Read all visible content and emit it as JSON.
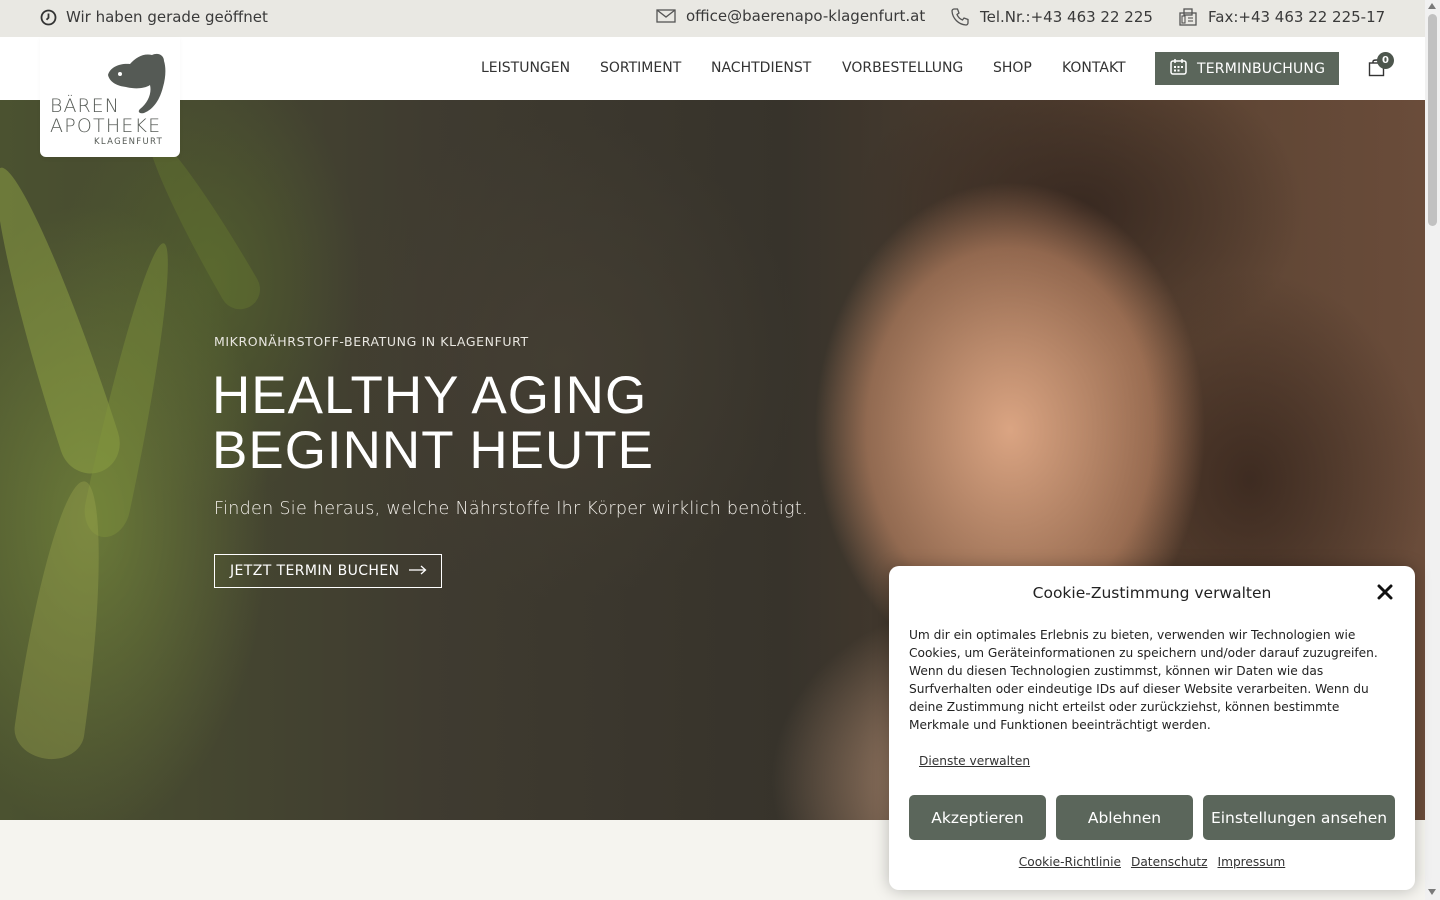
{
  "topbar": {
    "open_status": "Wir haben gerade geöffnet",
    "email": "office@baerenapo-klagenfurt.at",
    "phone": "Tel.Nr.:+43 463 22 225",
    "fax": "Fax:+43 463 22 225-17"
  },
  "logo": {
    "line1": "BÄREN",
    "line2": "APOTHEKE",
    "line3": "KLAGENFURT"
  },
  "nav": {
    "items": [
      "LEISTUNGEN",
      "SORTIMENT",
      "NACHTDIENST",
      "VORBESTELLUNG",
      "SHOP",
      "KONTAKT"
    ],
    "booking_label": "TERMINBUCHUNG",
    "cart_count": "0"
  },
  "hero": {
    "eyebrow": "MIKRONÄHRSTOFF-BERATUNG IN KLAGENFURT",
    "title_line1": "HEALTHY AGING",
    "title_line2": "BEGINNT HEUTE",
    "subtitle": "Finden Sie heraus, welche Nährstoffe Ihr Körper wirklich benötigt.",
    "cta_label": "JETZT TERMIN BUCHEN"
  },
  "cookie": {
    "title": "Cookie-Zustimmung verwalten",
    "body": "Um dir ein optimales Erlebnis zu bieten, verwenden wir Technologien wie Cookies, um Geräteinformationen zu speichern und/oder darauf zuzugreifen. Wenn du diesen Technologien zustimmst, können wir Daten wie das Surfverhalten oder eindeutige IDs auf dieser Website verarbeiten. Wenn du deine Zustimmung nicht erteilst oder zurückziehst, können bestimmte Merkmale und Funktionen beeinträchtigt werden.",
    "manage_link": "Dienste verwalten",
    "accept": "Akzeptieren",
    "decline": "Ablehnen",
    "settings": "Einstellungen ansehen",
    "links": [
      "Cookie-Richtlinie",
      "Datenschutz",
      "Impressum"
    ]
  },
  "colors": {
    "accent": "#5b665b",
    "topbar_bg": "#e9e8e3",
    "page_bg": "#f5f4ef"
  },
  "icons": {
    "open_status": "clock-icon",
    "email": "envelope-icon",
    "phone": "phone-icon",
    "fax": "fax-icon",
    "booking": "calendar-icon",
    "cart": "shopping-bag-icon",
    "cta": "arrow-right-icon",
    "close": "close-icon"
  }
}
